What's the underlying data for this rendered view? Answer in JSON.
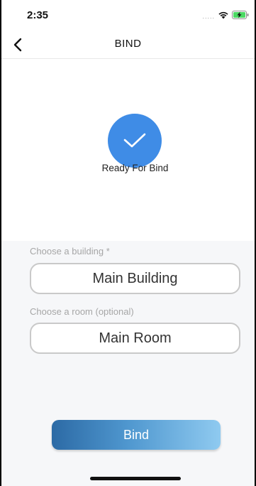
{
  "status_bar": {
    "time": "2:35",
    "signal": "....."
  },
  "nav": {
    "title": "BIND"
  },
  "ready": {
    "label": "Ready For Bind"
  },
  "form": {
    "building_label": "Choose a building *",
    "building_value": "Main Building",
    "room_label": "Choose a room (optional)",
    "room_value": "Main Room"
  },
  "actions": {
    "bind_label": "Bind"
  },
  "colors": {
    "check_circle": "#3f8ce6",
    "button_gradient_start": "#2c6aa5",
    "button_gradient_end": "#8fcaf0",
    "form_background": "#f6f7f9"
  }
}
